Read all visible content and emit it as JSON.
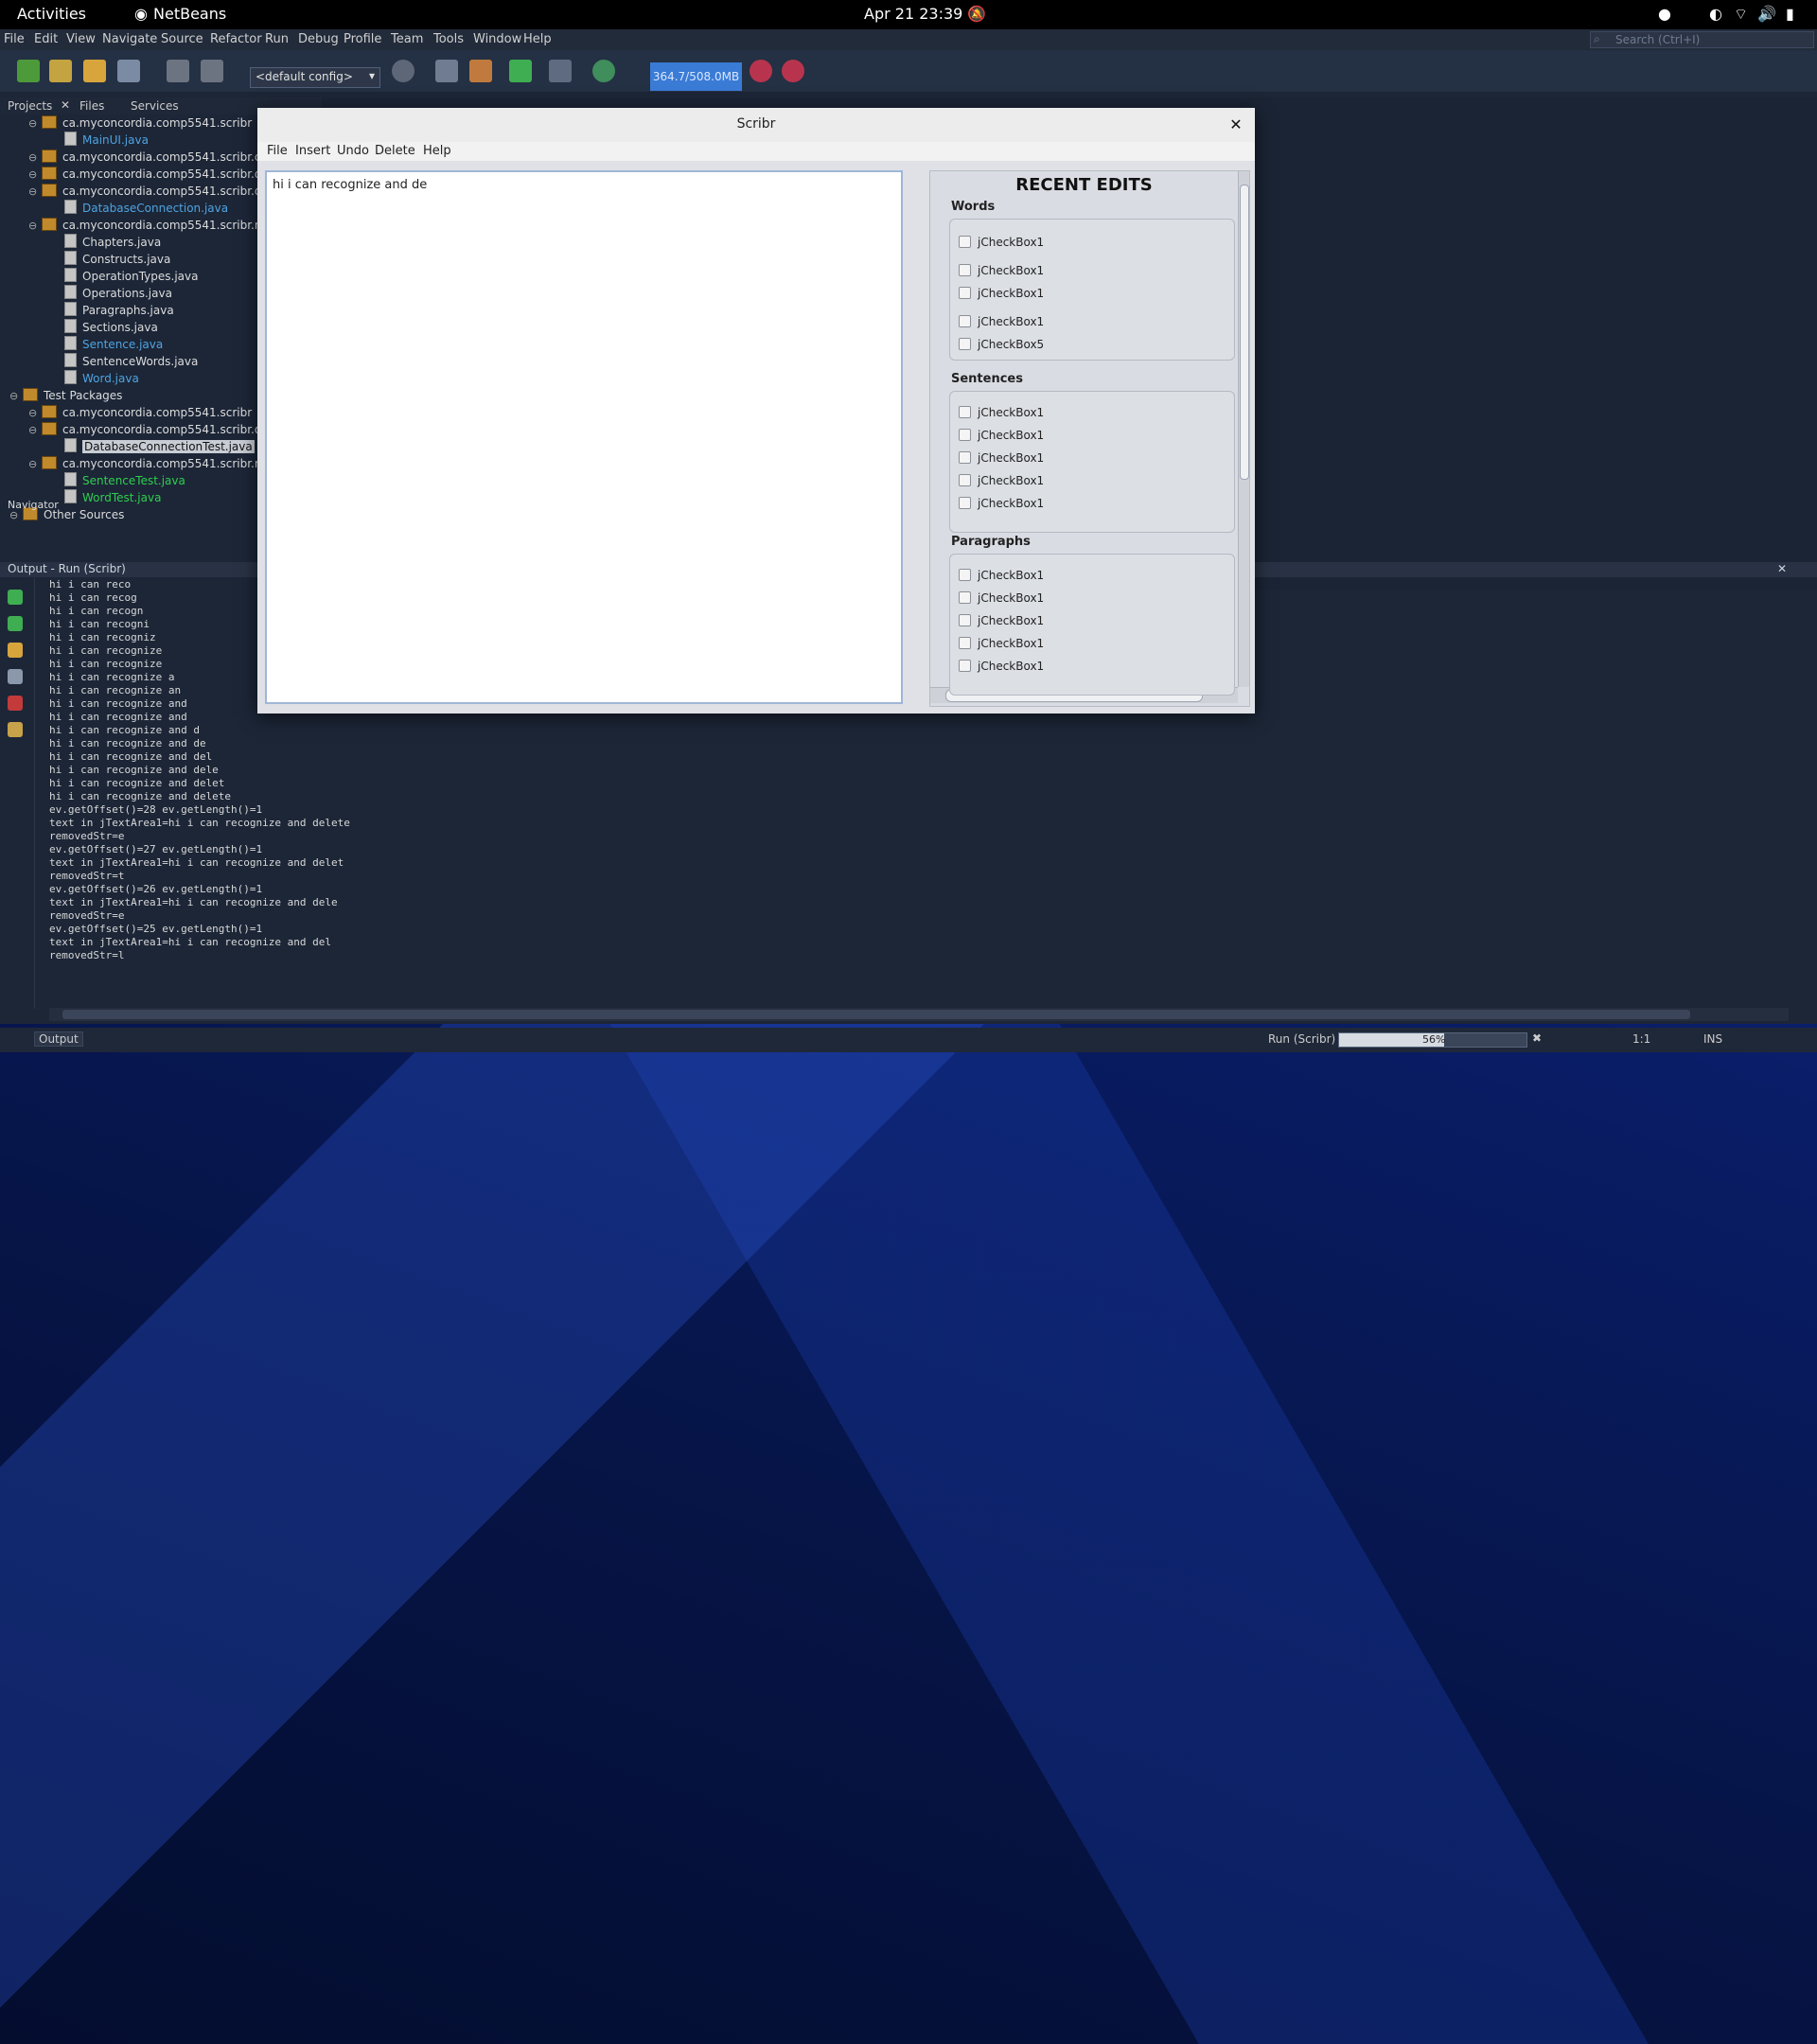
{
  "topbar": {
    "activities": "Activities",
    "app": "NetBeans",
    "clock": "Apr 21  23:39"
  },
  "netbeans": {
    "menu": [
      "File",
      "Edit",
      "View",
      "Navigate",
      "Source",
      "Refactor",
      "Run",
      "Debug",
      "Profile",
      "Team",
      "Tools",
      "Window",
      "Help"
    ],
    "search_placeholder": "Search (Ctrl+I)",
    "config": "<default config>",
    "memory": "364.7/508.0MB",
    "panel_tabs": [
      "Projects",
      "Files",
      "Services"
    ],
    "tree": [
      {
        "label": "ca.myconcordia.comp5541.scribr",
        "type": "package",
        "color": "white"
      },
      {
        "label": "MainUI.java",
        "type": "file",
        "color": "blue"
      },
      {
        "label": "ca.myconcordia.comp5541.scribr.c",
        "type": "package",
        "color": "white"
      },
      {
        "label": "ca.myconcordia.comp5541.scribr.d",
        "type": "package",
        "color": "white"
      },
      {
        "label": "ca.myconcordia.comp5541.scribr.d",
        "type": "package",
        "color": "white"
      },
      {
        "label": "DatabaseConnection.java",
        "type": "file",
        "color": "blue"
      },
      {
        "label": "ca.myconcordia.comp5541.scribr.m",
        "type": "package",
        "color": "white"
      },
      {
        "label": "Chapters.java",
        "type": "file",
        "color": "white"
      },
      {
        "label": "Constructs.java",
        "type": "file",
        "color": "white"
      },
      {
        "label": "OperationTypes.java",
        "type": "file",
        "color": "white"
      },
      {
        "label": "Operations.java",
        "type": "file",
        "color": "white"
      },
      {
        "label": "Paragraphs.java",
        "type": "file",
        "color": "white"
      },
      {
        "label": "Sections.java",
        "type": "file",
        "color": "white"
      },
      {
        "label": "Sentence.java",
        "type": "file",
        "color": "blue"
      },
      {
        "label": "SentenceWords.java",
        "type": "file",
        "color": "white"
      },
      {
        "label": "Word.java",
        "type": "file",
        "color": "blue"
      },
      {
        "label": "Test Packages",
        "type": "root",
        "color": "white"
      },
      {
        "label": "ca.myconcordia.comp5541.scribr",
        "type": "package",
        "color": "white"
      },
      {
        "label": "ca.myconcordia.comp5541.scribr.d",
        "type": "package",
        "color": "white"
      },
      {
        "label": "DatabaseConnectionTest.java",
        "type": "file",
        "color": "white",
        "selected": true
      },
      {
        "label": "ca.myconcordia.comp5541.scribr.m",
        "type": "package",
        "color": "white"
      },
      {
        "label": "SentenceTest.java",
        "type": "file",
        "color": "green"
      },
      {
        "label": "WordTest.java",
        "type": "file",
        "color": "green"
      },
      {
        "label": "Other Sources",
        "type": "root",
        "color": "white"
      }
    ],
    "navigator_tab": "Navigator",
    "output_title": "Output - Run (Scribr)",
    "output_lines": [
      "hi i can reco",
      "hi i can recog",
      "hi i can recogn",
      "hi i can recogni",
      "hi i can recogniz",
      "hi i can recognize",
      "hi i can recognize",
      "hi i can recognize a",
      "hi i can recognize an",
      "hi i can recognize and",
      "hi i can recognize and",
      "hi i can recognize and d",
      "hi i can recognize and de",
      "hi i can recognize and del",
      "hi i can recognize and dele",
      "hi i can recognize and delet",
      "hi i can recognize and delete",
      "ev.getOffset()=28 ev.getLength()=1",
      "text in jTextArea1=hi i can recognize and delete",
      "removedStr=e",
      "ev.getOffset()=27 ev.getLength()=1",
      "text in jTextArea1=hi i can recognize and delet",
      "removedStr=t",
      "ev.getOffset()=26 ev.getLength()=1",
      "text in jTextArea1=hi i can recognize and dele",
      "removedStr=e",
      "ev.getOffset()=25 ev.getLength()=1",
      "text in jTextArea1=hi i can recognize and del",
      "removedStr=l"
    ],
    "status": {
      "output_tab": "Output",
      "run_label": "Run (Scribr)",
      "progress_pct": 56,
      "progress_text": "56%",
      "position": "1:1",
      "mode": "INS"
    }
  },
  "scribr": {
    "title": "Scribr",
    "menu": [
      "File",
      "Insert",
      "Undo",
      "Delete",
      "Help"
    ],
    "text": "hi i can recognize and de",
    "recent_title": "RECENT EDITS",
    "groups": [
      {
        "title": "Words",
        "items": [
          "jCheckBox1",
          "jCheckBox1",
          "jCheckBox1",
          "jCheckBox1",
          "jCheckBox5"
        ]
      },
      {
        "title": "Sentences",
        "items": [
          "jCheckBox1",
          "jCheckBox1",
          "jCheckBox1",
          "jCheckBox1",
          "jCheckBox1"
        ]
      },
      {
        "title": "Paragraphs",
        "items": [
          "jCheckBox1",
          "jCheckBox1",
          "jCheckBox1",
          "jCheckBox1",
          "jCheckBox1"
        ]
      }
    ]
  }
}
